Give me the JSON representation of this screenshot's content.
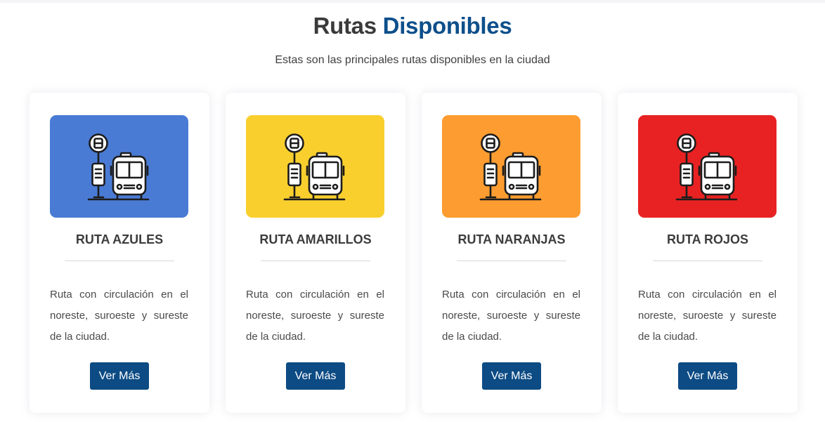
{
  "header": {
    "title_prefix": "Rutas",
    "title_accent": "Disponibles",
    "subtitle": "Estas son las principales rutas disponibles en la ciudad"
  },
  "colors": {
    "accent": "#0d4f8b",
    "button": "#0d4b84"
  },
  "routes": [
    {
      "name": "RUTA AZULES",
      "color": "#4a7bd4",
      "icon": "bus-stop-icon",
      "description": "Ruta con circulación en el noreste, suroeste y sureste de la ciudad.",
      "button_label": "Ver Más"
    },
    {
      "name": "RUTA AMARILLOS",
      "color": "#f9cf2e",
      "icon": "bus-stop-icon",
      "description": "Ruta con circulación en el noreste, suroeste y sureste de la ciudad.",
      "button_label": "Ver Más"
    },
    {
      "name": "RUTA NARANJAS",
      "color": "#fd9c30",
      "icon": "bus-stop-icon",
      "description": "Ruta con circulación en el noreste, suroeste y sureste de la ciudad.",
      "button_label": "Ver Más"
    },
    {
      "name": "RUTA ROJOS",
      "color": "#e82222",
      "icon": "bus-stop-icon",
      "description": "Ruta con circulación en el noreste, suroeste y sureste de la ciudad.",
      "button_label": "Ver Más"
    }
  ]
}
